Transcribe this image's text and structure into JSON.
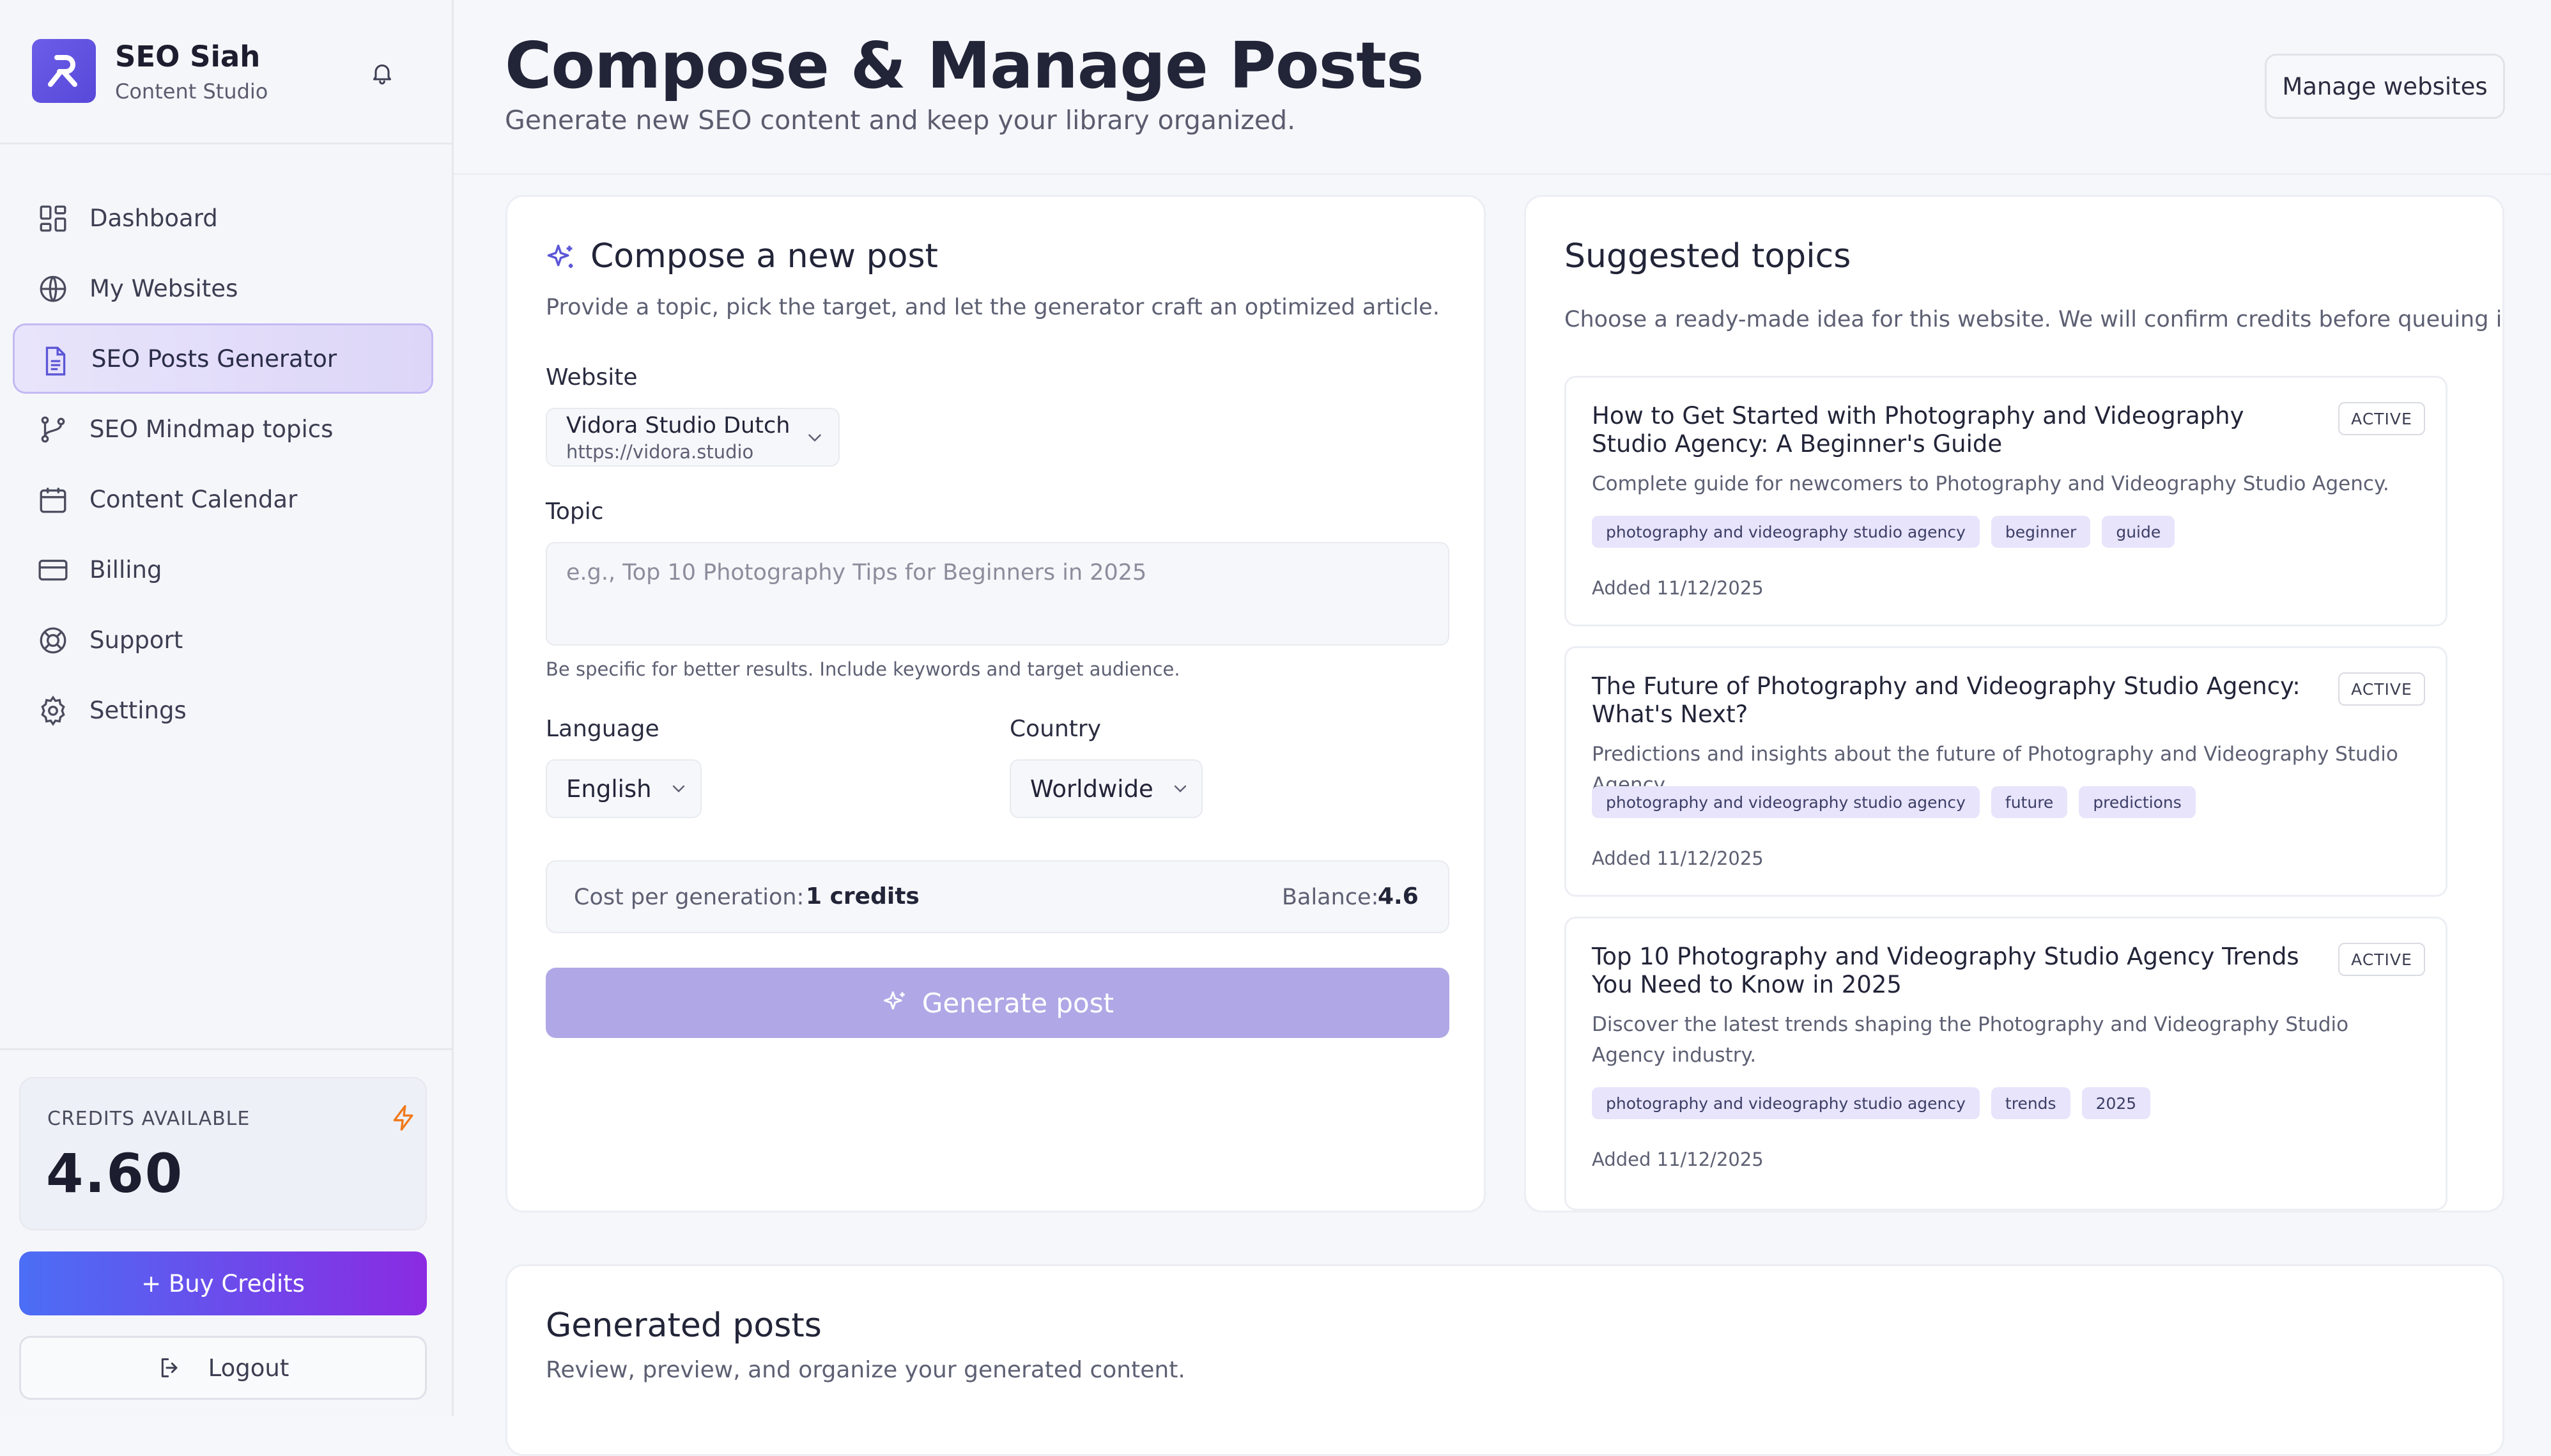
{
  "brand": {
    "name": "SEO Siah",
    "subtitle": "Content Studio"
  },
  "sidebar": {
    "items": [
      {
        "label": "Dashboard",
        "icon": "dashboard-icon",
        "active": false
      },
      {
        "label": "My Websites",
        "icon": "globe-icon",
        "active": false
      },
      {
        "label": "SEO Posts Generator",
        "icon": "document-icon",
        "active": true
      },
      {
        "label": "SEO Mindmap topics",
        "icon": "branch-icon",
        "active": false
      },
      {
        "label": "Content Calendar",
        "icon": "calendar-icon",
        "active": false
      },
      {
        "label": "Billing",
        "icon": "credit-card-icon",
        "active": false
      },
      {
        "label": "Support",
        "icon": "lifebuoy-icon",
        "active": false
      },
      {
        "label": "Settings",
        "icon": "gear-icon",
        "active": false
      }
    ],
    "credits": {
      "label": "CREDITS AVAILABLE",
      "value": "4.60"
    },
    "buy_label": "+ Buy Credits",
    "logout_label": "Logout"
  },
  "header": {
    "title": "Compose & Manage Posts",
    "subtitle": "Generate new SEO content and keep your library organized.",
    "manage_label": "Manage websites"
  },
  "compose": {
    "title": "Compose a new post",
    "description": "Provide a topic, pick the target, and let the generator craft an optimized article.",
    "website_label": "Website",
    "website_name": "Vidora Studio Dutch",
    "website_url": "https://vidora.studio",
    "topic_label": "Topic",
    "topic_value": "",
    "topic_placeholder": "e.g., Top 10 Photography Tips for Beginners in 2025",
    "topic_hint": "Be specific for better results. Include keywords and target audience.",
    "language_label": "Language",
    "language_value": "English",
    "country_label": "Country",
    "country_value": "Worldwide",
    "cost_label": "Cost per generation:",
    "cost_value": "1 credits",
    "balance_label": "Balance:",
    "balance_value": "4.6",
    "generate_label": "Generate post"
  },
  "topics": {
    "title": "Suggested topics",
    "description": "Choose a ready-made idea for this website. We will confirm credits before queuing it.",
    "items": [
      {
        "title": "How to Get Started with Photography and Videography Studio Agency: A Beginner's Guide",
        "badge": "ACTIVE",
        "description": "Complete guide for newcomers to Photography and Videography Studio Agency.",
        "tags": [
          "photography and videography studio agency",
          "beginner",
          "guide"
        ],
        "added": "Added 11/12/2025"
      },
      {
        "title": "The Future of Photography and Videography Studio Agency: What's Next?",
        "badge": "ACTIVE",
        "description": "Predictions and insights about the future of Photography and Videography Studio Agency.",
        "tags": [
          "photography and videography studio agency",
          "future",
          "predictions"
        ],
        "added": "Added 11/12/2025"
      },
      {
        "title": "Top 10 Photography and Videography Studio Agency Trends You Need to Know in 2025",
        "badge": "ACTIVE",
        "description": "Discover the latest trends shaping the Photography and Videography Studio Agency industry.",
        "tags": [
          "photography and videography studio agency",
          "trends",
          "2025"
        ],
        "added": "Added 11/12/2025"
      }
    ]
  },
  "generated": {
    "title": "Generated posts",
    "description": "Review, preview, and organize your generated content."
  }
}
